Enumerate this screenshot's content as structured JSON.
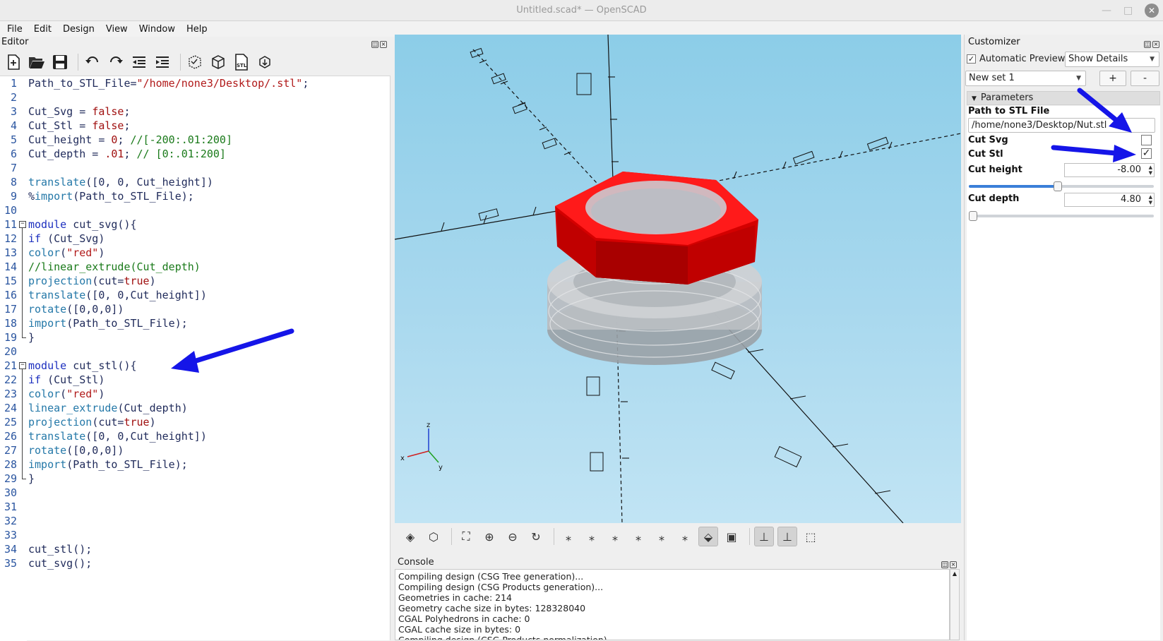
{
  "window": {
    "title": "Untitled.scad* — OpenSCAD",
    "min": "—",
    "max": "□",
    "close": "✕"
  },
  "menu": [
    "File",
    "Edit",
    "Design",
    "View",
    "Window",
    "Help"
  ],
  "editor": {
    "title": "Editor",
    "toolbar_icons": [
      "new-file-icon",
      "open-file-icon",
      "save-icon",
      "undo-icon",
      "redo-icon",
      "unindent-icon",
      "indent-icon",
      "preview-icon",
      "render-icon",
      "export-stl-icon",
      "send-to-print-icon"
    ],
    "lines": [
      {
        "n": "1",
        "parts": [
          [
            "plain",
            "Path_to_STL_File="
          ],
          [
            "str",
            "\"/home/none3/Desktop/.stl\""
          ],
          [
            "plain",
            ";"
          ]
        ]
      },
      {
        "n": "2",
        "parts": []
      },
      {
        "n": "3",
        "parts": [
          [
            "plain",
            "Cut_Svg = "
          ],
          [
            "val",
            "false"
          ],
          [
            "plain",
            ";"
          ]
        ]
      },
      {
        "n": "4",
        "parts": [
          [
            "plain",
            "Cut_Stl = "
          ],
          [
            "val",
            "false"
          ],
          [
            "plain",
            ";"
          ]
        ]
      },
      {
        "n": "5",
        "parts": [
          [
            "plain",
            "Cut_height = "
          ],
          [
            "val",
            "0"
          ],
          [
            "plain",
            "; "
          ],
          [
            "cmt",
            "//[-200:.01:200]"
          ]
        ]
      },
      {
        "n": "6",
        "parts": [
          [
            "plain",
            "Cut_depth = "
          ],
          [
            "val",
            ".01"
          ],
          [
            "plain",
            "; "
          ],
          [
            "cmt",
            "// [0:.01:200]"
          ]
        ]
      },
      {
        "n": "7",
        "parts": []
      },
      {
        "n": "8",
        "parts": [
          [
            "fn",
            "translate"
          ],
          [
            "plain",
            "([0, 0, Cut_height])"
          ]
        ]
      },
      {
        "n": "9",
        "parts": [
          [
            "plain",
            "%"
          ],
          [
            "fn",
            "import"
          ],
          [
            "plain",
            "(Path_to_STL_File);"
          ]
        ]
      },
      {
        "n": "10",
        "parts": []
      },
      {
        "n": "11",
        "parts": [
          [
            "kw",
            "module"
          ],
          [
            "plain",
            " cut_svg(){"
          ]
        ]
      },
      {
        "n": "12",
        "parts": [
          [
            "kw",
            "if"
          ],
          [
            "plain",
            " (Cut_Svg)"
          ]
        ]
      },
      {
        "n": "13",
        "parts": [
          [
            "fn",
            "color"
          ],
          [
            "plain",
            "("
          ],
          [
            "str",
            "\"red\""
          ],
          [
            "plain",
            ")"
          ]
        ]
      },
      {
        "n": "14",
        "parts": [
          [
            "cmt",
            "//linear_extrude(Cut_depth)"
          ]
        ]
      },
      {
        "n": "15",
        "parts": [
          [
            "fn",
            "projection"
          ],
          [
            "plain",
            "(cut="
          ],
          [
            "val",
            "true"
          ],
          [
            "plain",
            ")"
          ]
        ]
      },
      {
        "n": "16",
        "parts": [
          [
            "fn",
            "translate"
          ],
          [
            "plain",
            "([0, 0,Cut_height])"
          ]
        ]
      },
      {
        "n": "17",
        "parts": [
          [
            "fn",
            "rotate"
          ],
          [
            "plain",
            "([0,0,0])"
          ]
        ]
      },
      {
        "n": "18",
        "parts": [
          [
            "fn",
            "import"
          ],
          [
            "plain",
            "(Path_to_STL_File);"
          ]
        ]
      },
      {
        "n": "19",
        "parts": [
          [
            "plain",
            "}"
          ]
        ]
      },
      {
        "n": "20",
        "parts": []
      },
      {
        "n": "21",
        "parts": [
          [
            "kw",
            "module"
          ],
          [
            "plain",
            " cut_stl(){"
          ]
        ]
      },
      {
        "n": "22",
        "parts": [
          [
            "kw",
            "if"
          ],
          [
            "plain",
            " (Cut_Stl)"
          ]
        ]
      },
      {
        "n": "23",
        "parts": [
          [
            "fn",
            "color"
          ],
          [
            "plain",
            "("
          ],
          [
            "str",
            "\"red\""
          ],
          [
            "plain",
            ")"
          ]
        ]
      },
      {
        "n": "24",
        "parts": [
          [
            "fn",
            "linear_extrude"
          ],
          [
            "plain",
            "(Cut_depth)"
          ]
        ]
      },
      {
        "n": "25",
        "parts": [
          [
            "fn",
            "projection"
          ],
          [
            "plain",
            "(cut="
          ],
          [
            "val",
            "true"
          ],
          [
            "plain",
            ")"
          ]
        ]
      },
      {
        "n": "26",
        "parts": [
          [
            "fn",
            "translate"
          ],
          [
            "plain",
            "([0, 0,Cut_height])"
          ]
        ]
      },
      {
        "n": "27",
        "parts": [
          [
            "fn",
            "rotate"
          ],
          [
            "plain",
            "([0,0,0])"
          ]
        ]
      },
      {
        "n": "28",
        "parts": [
          [
            "fn",
            "import"
          ],
          [
            "plain",
            "(Path_to_STL_File);"
          ]
        ]
      },
      {
        "n": "29",
        "parts": [
          [
            "plain",
            "}"
          ]
        ]
      },
      {
        "n": "30",
        "parts": []
      },
      {
        "n": "31",
        "parts": []
      },
      {
        "n": "32",
        "parts": []
      },
      {
        "n": "33",
        "parts": []
      },
      {
        "n": "34",
        "parts": [
          [
            "plain",
            "cut_stl();"
          ]
        ]
      },
      {
        "n": "35",
        "parts": [
          [
            "plain",
            "cut_svg();"
          ]
        ]
      }
    ]
  },
  "viewport": {
    "axis_labels": {
      "x": "x",
      "y": "y",
      "z": "z"
    },
    "model_color": "#ff0000",
    "ghost_color": "#b9bec2",
    "background_top": "#8ccde8",
    "background_bottom": "#c1e4f4",
    "toolbar_icons": [
      "preview-icon",
      "render-icon",
      "view-all-icon",
      "zoom-in-icon",
      "zoom-out-icon",
      "reset-view-icon",
      "view-right-icon",
      "view-left-icon",
      "view-back-icon",
      "view-front-icon",
      "view-top-icon",
      "view-bottom-icon",
      "perspective-icon",
      "orthogonal-icon",
      "show-axes-icon",
      "show-scale-markers-icon",
      "show-edges-icon"
    ]
  },
  "console": {
    "title": "Console",
    "lines": [
      "Compiling design (CSG Tree generation)...",
      "Compiling design (CSG Products generation)...",
      "Geometries in cache: 214",
      "Geometry cache size in bytes: 128328040",
      "CGAL Polyhedrons in cache: 0",
      "CGAL cache size in bytes: 0",
      "Compiling design (CSG Products normalization)..."
    ]
  },
  "customizer": {
    "title": "Customizer",
    "auto_preview_label": "Automatic Preview",
    "auto_preview_checked": "✓",
    "details_select": "Show Details",
    "preset_select": "New set 1",
    "add_btn": "+",
    "remove_btn": "-",
    "group_label": "Parameters",
    "params": {
      "path_label": "Path to STL File",
      "path_value": "/home/none3/Desktop/Nut.stl",
      "cut_svg_label": "Cut Svg",
      "cut_stl_label": "Cut Stl",
      "cut_stl_check": "✓",
      "cut_height_label": "Cut height",
      "cut_height_value": "-8.00",
      "cut_height_fraction": 0.48,
      "cut_depth_label": "Cut depth",
      "cut_depth_value": "4.80",
      "cut_depth_fraction": 0.024
    }
  },
  "annotation_color": "#1515e8"
}
